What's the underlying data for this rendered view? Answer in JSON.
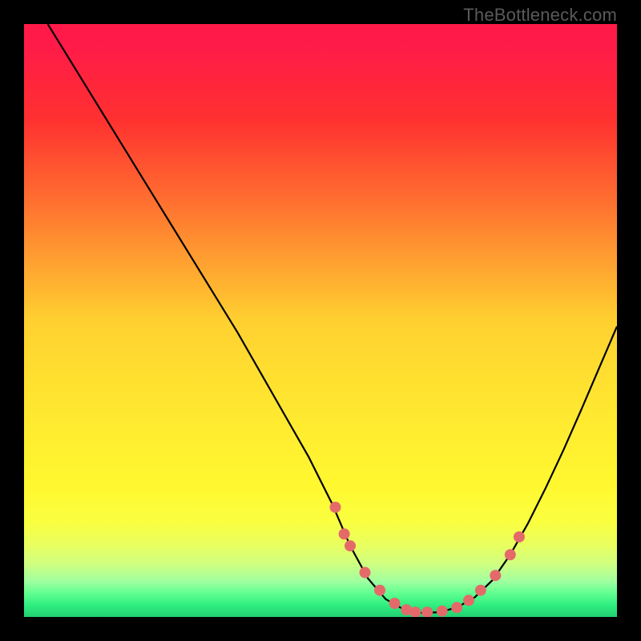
{
  "watermark": "TheBottleneck.com",
  "chart_data": {
    "type": "line",
    "title": "",
    "xlabel": "",
    "ylabel": "",
    "xlim": [
      0,
      100
    ],
    "ylim": [
      0,
      100
    ],
    "curve": {
      "x": [
        4,
        8,
        12,
        16,
        20,
        24,
        28,
        32,
        36,
        40,
        44,
        48,
        52,
        55,
        58,
        61,
        64,
        67,
        70,
        73,
        76,
        79,
        82,
        85,
        88,
        91,
        94,
        97,
        100
      ],
      "y": [
        100,
        93.5,
        87,
        80.5,
        74,
        67.5,
        61,
        54.5,
        48,
        41,
        34,
        27,
        19,
        12,
        6.5,
        3,
        1.3,
        0.7,
        0.8,
        1.6,
        3.3,
        6.2,
        10.5,
        15.8,
        21.8,
        28.2,
        35,
        42,
        49
      ]
    },
    "markers": {
      "x": [
        52.5,
        54.0,
        55.0,
        57.5,
        60.0,
        62.5,
        64.5,
        66.0,
        68.0,
        70.5,
        73.0,
        75.0,
        77.0,
        79.5,
        82.0,
        83.5
      ],
      "y": [
        18.5,
        14.0,
        12.0,
        7.5,
        4.5,
        2.3,
        1.2,
        0.8,
        0.8,
        1.0,
        1.6,
        2.8,
        4.5,
        7.0,
        10.5,
        13.5
      ]
    },
    "marker_style": {
      "color": "#e46a6a",
      "radius_px": 7
    }
  }
}
